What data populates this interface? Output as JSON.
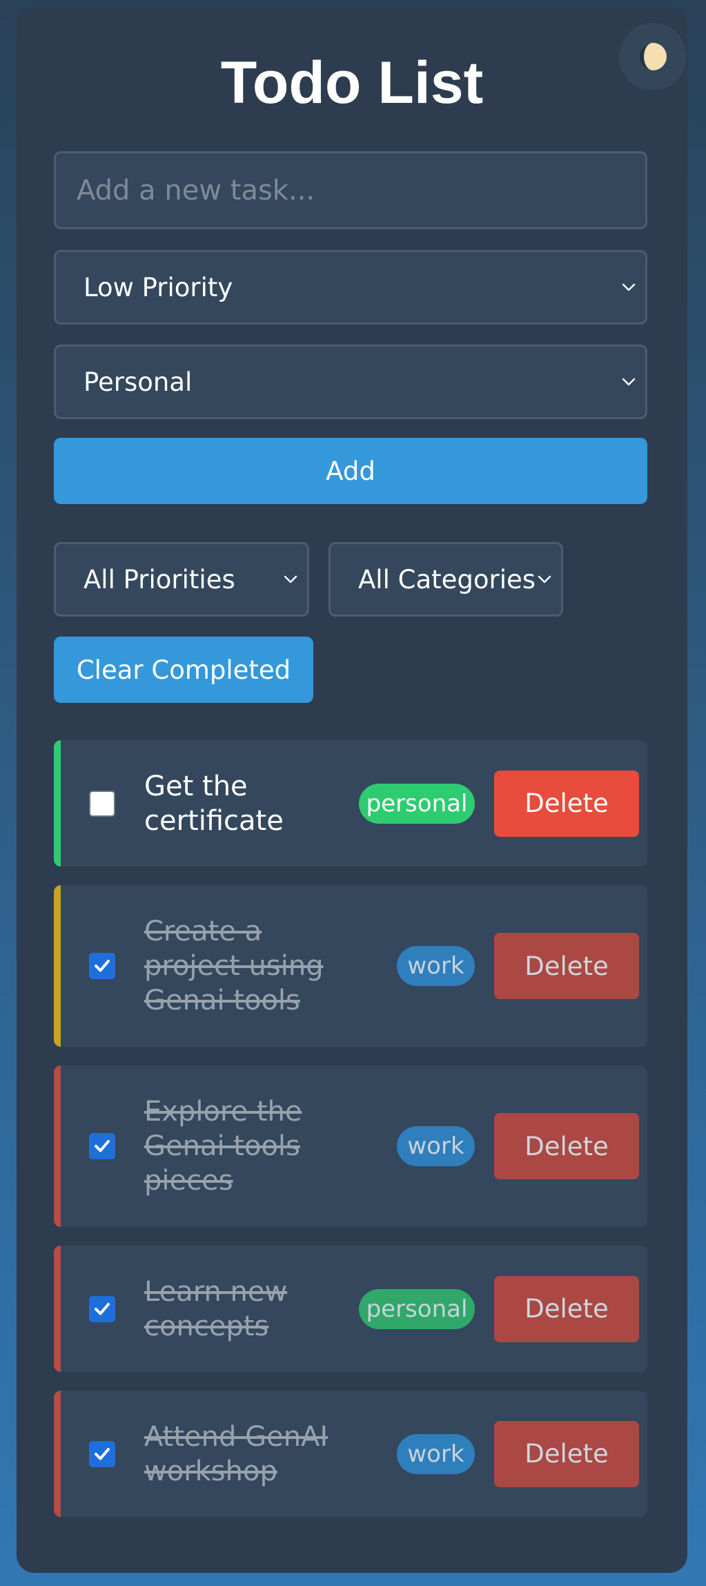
{
  "app": {
    "title": "Todo List",
    "theme_toggle_icon": "moon-icon"
  },
  "form": {
    "task_placeholder": "Add a new task...",
    "task_value": "",
    "priority_selected": "Low Priority",
    "category_selected": "Personal",
    "add_label": "Add"
  },
  "filters": {
    "priority_selected": "All Priorities",
    "category_selected": "All Categories",
    "clear_label": "Clear Completed"
  },
  "tasks": [
    {
      "text": "Get the certificate",
      "category": "personal",
      "completed": false,
      "priority_color": "#2ecc71",
      "delete_label": "Delete"
    },
    {
      "text": "Create a project using Genai tools",
      "category": "work",
      "completed": true,
      "priority_color": "#c9a227",
      "delete_label": "Delete"
    },
    {
      "text": "Explore the Genai tools pieces",
      "category": "work",
      "completed": true,
      "priority_color": "#b94a44",
      "delete_label": "Delete"
    },
    {
      "text": "Learn new concepts",
      "category": "personal",
      "completed": true,
      "priority_color": "#b94a44",
      "delete_label": "Delete"
    },
    {
      "text": "Attend GenAI workshop",
      "category": "work",
      "completed": true,
      "priority_color": "#b94a44",
      "delete_label": "Delete"
    }
  ],
  "colors": {
    "accent": "#3498db",
    "danger": "#e74c3c",
    "personal_tag": "#2ecc71",
    "card_bg": "#2d3c4f"
  }
}
